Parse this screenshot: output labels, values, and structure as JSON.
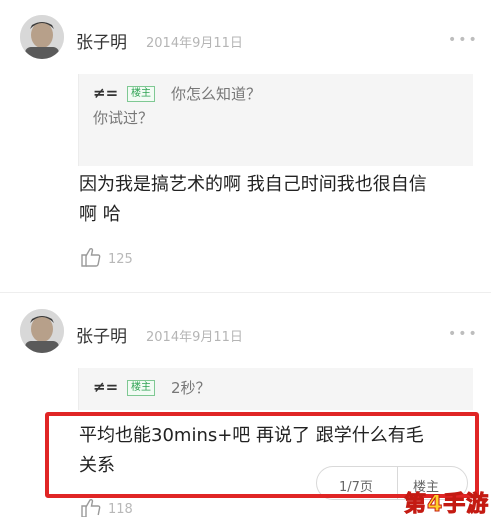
{
  "comments": [
    {
      "author": "张子明",
      "date": "2014年9月11日",
      "more": "•••",
      "quote": {
        "user": "≠=",
        "badge": "楼主",
        "lines": [
          "你怎么知道？",
          "你试过？"
        ]
      },
      "lines": [
        "因为我是搞艺术的啊 我自己时间我也很自信",
        "啊 哈"
      ],
      "likes": "125"
    },
    {
      "author": "张子明",
      "date": "2014年9月11日",
      "more": "•••",
      "quote": {
        "user": "≠=",
        "badge": "楼主",
        "lines": [
          "2秒？"
        ]
      },
      "lines": [
        "平均也能30mins+吧 再说了 跟学什么有毛",
        "关系"
      ],
      "likes": "118"
    }
  ],
  "pager": {
    "page": "1/7页",
    "op_label": "楼主"
  },
  "watermark": "第4手游",
  "colors": {
    "highlight": "#e02525",
    "badge": "#2fa354"
  },
  "icons": [
    "avatar",
    "more-dots-icon",
    "thumbs-up-icon"
  ]
}
